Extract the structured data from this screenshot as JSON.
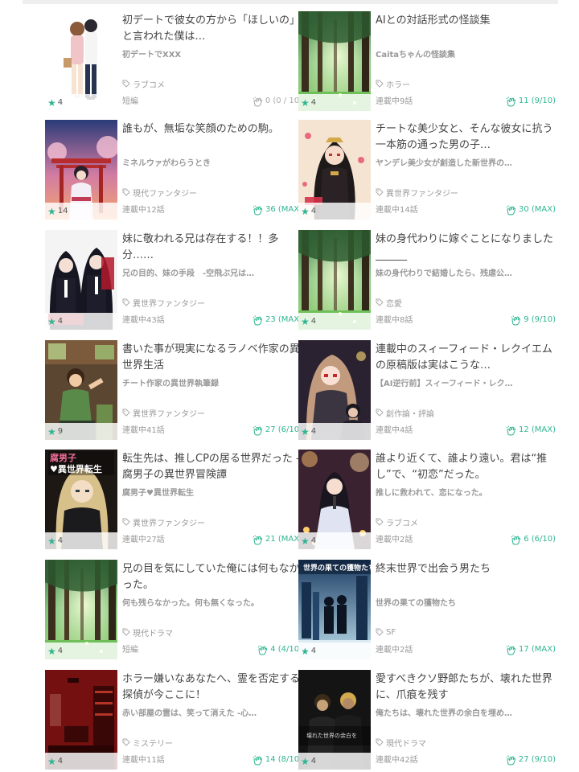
{
  "colors": {
    "accent": "#30b592",
    "muted": "#999999",
    "title": "#444444"
  },
  "works": [
    {
      "title": "初デートで彼女の方から「ほしいの」と言われた僕は…",
      "subtitle": "初デートでXXX",
      "genre": "ラブコメ",
      "status": "短編",
      "reaction": "0 (0 / 10)",
      "rating": "4",
      "thumb": "couple"
    },
    {
      "title": "AIとの対話形式の怪談集",
      "subtitle": "Caitaちゃんの怪談集",
      "genre": "ホラー",
      "status": "連載中9話",
      "reaction": "11 (9/10)",
      "rating": "4",
      "thumb": "forest"
    },
    {
      "title": "誰もが、無垢な笑顔のための駒。",
      "subtitle": "ミネルウァがわらうとき",
      "genre": "現代ファンタジー",
      "status": "連載中12話",
      "reaction": "36 (MAX)",
      "rating": "14",
      "thumb": "shrine"
    },
    {
      "title": "チートな美少女と、そんな彼女に抗う一本筋の通った男の子…",
      "subtitle": "ヤンデレ美少女が創造した新世界の…",
      "genre": "異世界ファンタジー",
      "status": "連載中14話",
      "reaction": "30 (MAX)",
      "rating": "4",
      "thumb": "darkgirl"
    },
    {
      "title": "妹に敬われる兄は存在する！！多分……",
      "subtitle": "兄の目的、妹の手段　-空飛ぶ兄は…",
      "genre": "異世界ファンタジー",
      "status": "連載中43話",
      "reaction": "23 (MAX)",
      "rating": "4",
      "thumb": "sisters"
    },
    {
      "title": "妹の身代わりに嫁ぐことになりました______",
      "subtitle": "妹の身代わりで結婚したら、残虐公…",
      "genre": "恋愛",
      "status": "連載中8話",
      "reaction": "9 (9/10)",
      "rating": "4",
      "thumb": "forest"
    },
    {
      "title": "書いた事が現実になるラノベ作家の異世界生活",
      "subtitle": "チート作家の異世界執筆録",
      "genre": "異世界ファンタジー",
      "status": "連載中41話",
      "reaction": "27 (6/10)",
      "rating": "9",
      "thumb": "boy"
    },
    {
      "title": "連載中のスィーフィード・レクイエムの原稿版は実はこうな…",
      "subtitle": "【AI逆行前】スィーフィード・レク…",
      "genre": "創作論・評論",
      "status": "連載中4話",
      "reaction": "12 (MAX)",
      "rating": "4",
      "thumb": "redeyes"
    },
    {
      "title": "転生先は、推しCPの居る世界だった - 腐男子の異世界冒険譚",
      "subtitle": "腐男子♥異世界転生",
      "genre": "異世界ファンタジー",
      "status": "連載中27話",
      "reaction": "21 (MAX)",
      "rating": "4",
      "thumb": "blond"
    },
    {
      "title": "誰より近くて、誰より遠い。君は“推し”で、“初恋”だった。",
      "subtitle": "推しに救われて、恋になった。",
      "genre": "ラブコメ",
      "status": "連載中2話",
      "reaction": "6 (6/10)",
      "rating": "4",
      "thumb": "idol"
    },
    {
      "title": "兄の目を気にしていた俺には何もなかった。",
      "subtitle": "何も残らなかった。何も無くなった。",
      "genre": "現代ドラマ",
      "status": "短編",
      "reaction": "4 (4/10)",
      "rating": "4",
      "thumb": "forest"
    },
    {
      "title": "終末世界で出会う男たち",
      "subtitle": "世界の果ての獲物たち",
      "genre": "SF",
      "status": "連載中2話",
      "reaction": "17 (MAX)",
      "rating": "4",
      "thumb": "endworld"
    },
    {
      "title": "ホラー嫌いなあなたへ、霊を否定する探偵が今ここに！",
      "subtitle": "赤い部屋の霊は、笑って消えた -心…",
      "genre": "ミステリー",
      "status": "連載中11話",
      "reaction": "14 (8/10)",
      "rating": "4",
      "thumb": "redroom"
    },
    {
      "title": "愛すべきクソ野郎たちが、壊れた世界に、爪痕を残す",
      "subtitle": "俺たちは、壊れた世界の余白を埋め…",
      "genre": "現代ドラマ",
      "status": "連載中42話",
      "reaction": "27 (9/10)",
      "rating": "4",
      "thumb": "darkmen"
    }
  ]
}
